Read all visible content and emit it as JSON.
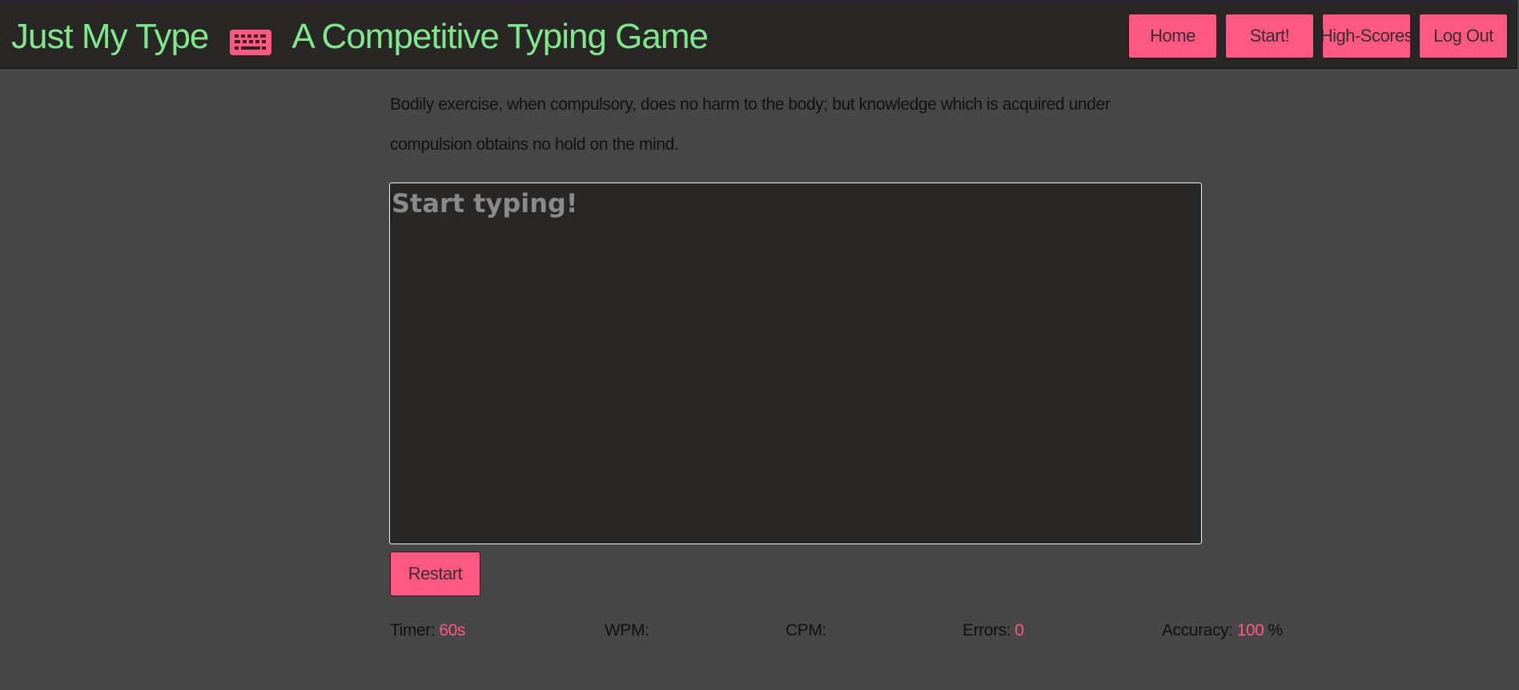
{
  "header": {
    "title": "Just My Type",
    "icon": "keyboard-icon",
    "subtitle": "A Competitive Typing Game",
    "nav": [
      {
        "label": "Home"
      },
      {
        "label": "Start!"
      },
      {
        "label": "High-Scores"
      },
      {
        "label": "Log Out"
      }
    ]
  },
  "quote": {
    "text": "Bodily exercise, when compulsory, does no harm to the body; but knowledge which is acquired under compulsion obtains no hold on the mind."
  },
  "typing": {
    "placeholder": "Start typing!",
    "value": ""
  },
  "restart_label": "Restart",
  "stats": {
    "timer_label": "Timer:",
    "timer_value": "60s",
    "wpm_label": "WPM:",
    "wpm_value": "",
    "cpm_label": "CPM:",
    "cpm_value": "",
    "errors_label": "Errors:",
    "errors_value": "0",
    "accuracy_label": "Accuracy:",
    "accuracy_value": "100",
    "accuracy_unit": "%"
  },
  "colors": {
    "accent": "#ff5983",
    "title_green": "#80e88a",
    "background": "#474747",
    "header_bg": "#292626",
    "text_area_bg": "#292626"
  }
}
